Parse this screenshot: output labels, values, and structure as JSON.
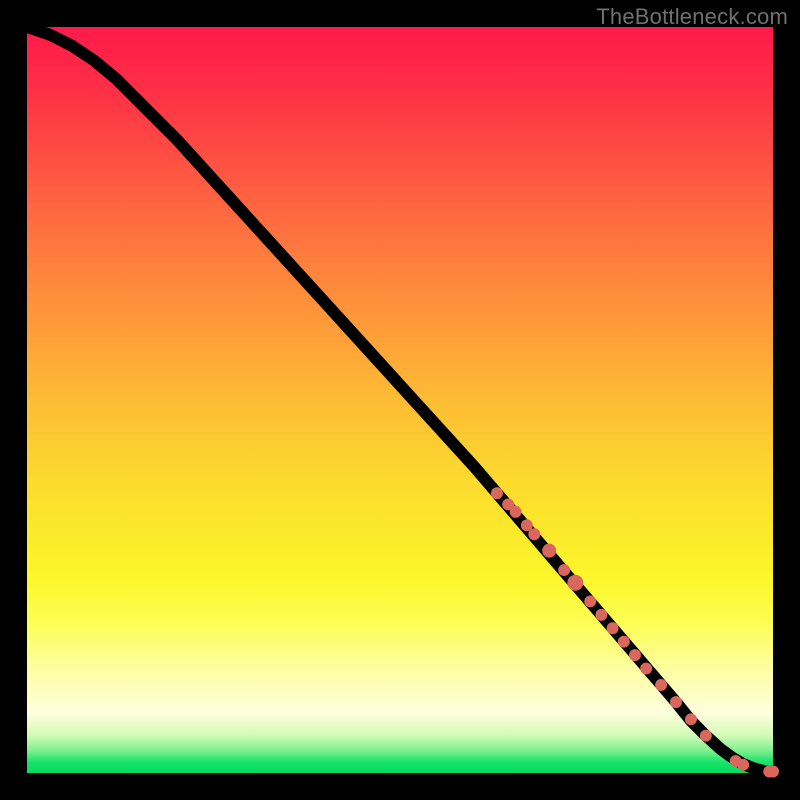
{
  "watermark": "TheBottleneck.com",
  "palette": {
    "frame_bg": "#000000",
    "marker": "#d9675c"
  },
  "chart_data": {
    "type": "line",
    "title": "",
    "xlabel": "",
    "ylabel": "",
    "xlim": [
      0,
      100
    ],
    "ylim": [
      0,
      100
    ],
    "grid": false,
    "legend": false,
    "series": [
      {
        "name": "bottleneck-curve",
        "x": [
          0,
          3,
          6,
          9,
          12,
          15,
          20,
          25,
          30,
          35,
          40,
          45,
          50,
          55,
          60,
          63,
          66,
          69,
          72,
          75,
          78,
          81,
          84,
          87,
          89,
          91,
          93,
          94.5,
          96,
          97.5,
          99,
          100
        ],
        "y": [
          100,
          99,
          97.5,
          95.5,
          93,
          90,
          85,
          79.5,
          74,
          68.5,
          63,
          57.5,
          52,
          46.5,
          41,
          37.5,
          34,
          30.5,
          27,
          23.5,
          20,
          16.5,
          13,
          9.5,
          7,
          5,
          3.2,
          2.1,
          1.2,
          0.6,
          0.2,
          0.2
        ]
      }
    ],
    "markers": {
      "name": "highlighted-points",
      "x": [
        63,
        64.5,
        65.5,
        67,
        68,
        70,
        72,
        73.5,
        75.5,
        77,
        78.5,
        80,
        81.5,
        83,
        85,
        87,
        89,
        91,
        95,
        96,
        99.5,
        100
      ],
      "y": [
        37.5,
        36,
        35,
        33.2,
        32,
        29.8,
        27.2,
        25.5,
        23,
        21.2,
        19.4,
        17.6,
        15.8,
        14,
        11.8,
        9.5,
        7.2,
        5,
        1.6,
        1.1,
        0.2,
        0.2
      ],
      "r": [
        6,
        6,
        6,
        6,
        6,
        7,
        6,
        8,
        6,
        6,
        6,
        6,
        6,
        6,
        6,
        6,
        6,
        6,
        6,
        6,
        6,
        6
      ]
    }
  }
}
